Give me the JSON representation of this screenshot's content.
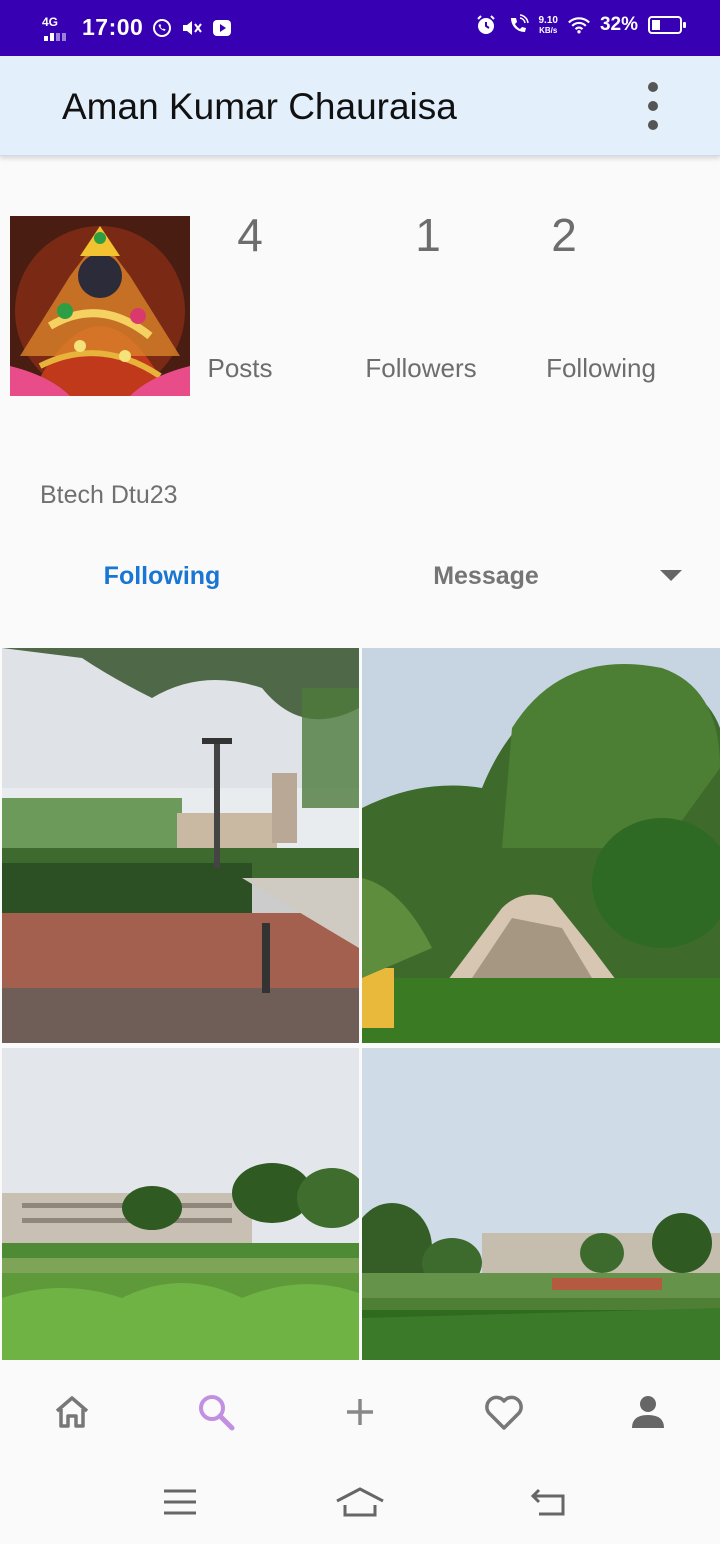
{
  "status_bar": {
    "network": "4G",
    "time": "17:00",
    "speed_value": "9.10",
    "speed_unit": "KB/s",
    "battery_percent": "32%",
    "battery_level": 0.32
  },
  "app_bar": {
    "title": "Aman Kumar Chauraisa",
    "overflow_icon": "more-vert-icon"
  },
  "profile": {
    "avatar_icon": "profile-photo",
    "stats": [
      {
        "count": "4",
        "label": "Posts"
      },
      {
        "count": "1",
        "label": "Followers"
      },
      {
        "count": "2",
        "label": "Following"
      }
    ],
    "bio": "Btech Dtu23",
    "following_button": "Following",
    "message_button": "Message",
    "accent_color": "#1976d2"
  },
  "posts": [
    {
      "icon": "campus-plaza-photo"
    },
    {
      "icon": "garden-fountain-photo"
    },
    {
      "icon": "campus-lawn-photo"
    },
    {
      "icon": "campus-field-photo"
    }
  ],
  "bottom_nav": {
    "items": [
      "home-icon",
      "search-icon",
      "add-icon",
      "heart-icon",
      "person-icon"
    ],
    "active": "search-icon",
    "active_color": "#c290e0"
  },
  "system_nav": {
    "items": [
      "menu-icon",
      "home-outline-icon",
      "back-icon"
    ]
  }
}
